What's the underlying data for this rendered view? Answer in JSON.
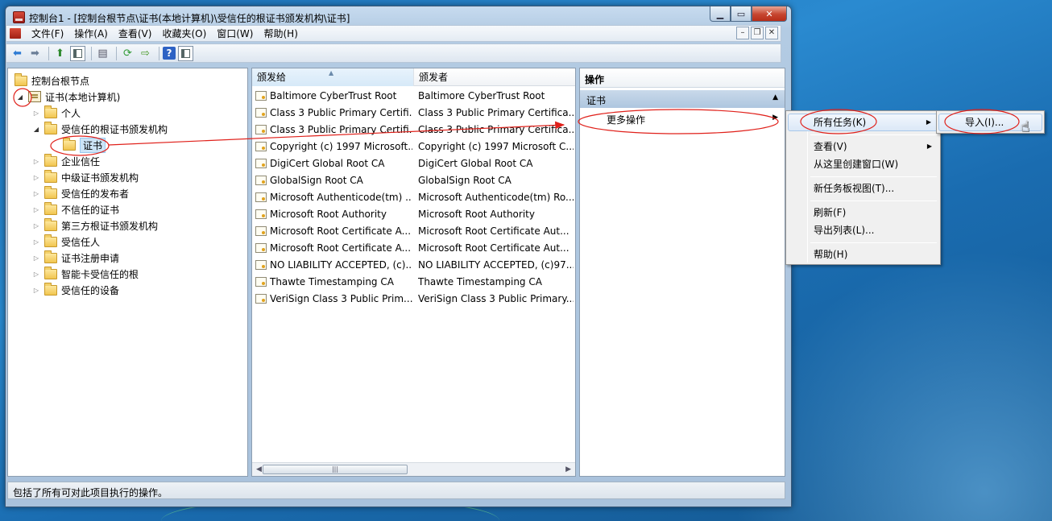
{
  "window": {
    "title": "控制台1 - [控制台根节点\\证书(本地计算机)\\受信任的根证书颁发机构\\证书]"
  },
  "menubar": {
    "items": [
      "文件(F)",
      "操作(A)",
      "查看(V)",
      "收藏夹(O)",
      "窗口(W)",
      "帮助(H)"
    ]
  },
  "toolbar": {
    "icons": [
      "back-arrow-icon",
      "forward-arrow-icon",
      "up-folder-icon",
      "show-tree-icon",
      "copy-icon",
      "refresh-icon",
      "export-list-icon",
      "help-icon",
      "action-pane-icon"
    ]
  },
  "tree": {
    "root": "控制台根节点",
    "store": "证书(本地计算机)",
    "items": [
      {
        "label": "个人"
      },
      {
        "label": "受信任的根证书颁发机构"
      },
      {
        "label": "证书"
      },
      {
        "label": "企业信任"
      },
      {
        "label": "中级证书颁发机构"
      },
      {
        "label": "受信任的发布者"
      },
      {
        "label": "不信任的证书"
      },
      {
        "label": "第三方根证书颁发机构"
      },
      {
        "label": "受信任人"
      },
      {
        "label": "证书注册申请"
      },
      {
        "label": "智能卡受信任的根"
      },
      {
        "label": "受信任的设备"
      }
    ]
  },
  "list": {
    "columns": [
      "颁发给",
      "颁发者"
    ],
    "rows": [
      {
        "issued_to": "Baltimore CyberTrust Root",
        "issued_by": "Baltimore CyberTrust Root"
      },
      {
        "issued_to": "Class 3 Public Primary Certifi...",
        "issued_by": "Class 3 Public Primary Certifica..."
      },
      {
        "issued_to": "Class 3 Public Primary Certifi...",
        "issued_by": "Class 3 Public Primary Certifica..."
      },
      {
        "issued_to": "Copyright (c) 1997 Microsoft...",
        "issued_by": "Copyright (c) 1997 Microsoft C..."
      },
      {
        "issued_to": "DigiCert Global Root CA",
        "issued_by": "DigiCert Global Root CA"
      },
      {
        "issued_to": "GlobalSign Root CA",
        "issued_by": "GlobalSign Root CA"
      },
      {
        "issued_to": "Microsoft Authenticode(tm) ...",
        "issued_by": "Microsoft Authenticode(tm) Ro..."
      },
      {
        "issued_to": "Microsoft Root Authority",
        "issued_by": "Microsoft Root Authority"
      },
      {
        "issued_to": "Microsoft Root Certificate A...",
        "issued_by": "Microsoft Root Certificate Aut..."
      },
      {
        "issued_to": "Microsoft Root Certificate A...",
        "issued_by": "Microsoft Root Certificate Aut..."
      },
      {
        "issued_to": "NO LIABILITY ACCEPTED, (c)...",
        "issued_by": "NO LIABILITY ACCEPTED, (c)97..."
      },
      {
        "issued_to": "Thawte Timestamping CA",
        "issued_by": "Thawte Timestamping CA"
      },
      {
        "issued_to": "VeriSign Class 3 Public Prim...",
        "issued_by": "VeriSign Class 3 Public Primary..."
      }
    ]
  },
  "actions": {
    "header": "操作",
    "group": "证书",
    "more": "更多操作"
  },
  "context_menu": {
    "items": [
      "所有任务(K)",
      "查看(V)",
      "从这里创建窗口(W)",
      "新任务板视图(T)...",
      "刷新(F)",
      "导出列表(L)...",
      "帮助(H)"
    ]
  },
  "submenu": {
    "items": [
      "导入(I)..."
    ]
  },
  "statusbar": {
    "text": "包括了所有可对此项目执行的操作。"
  },
  "colors": {
    "annotation": "#e0201a",
    "selection": "#cce4f7",
    "action_group": "#b8cde3"
  }
}
